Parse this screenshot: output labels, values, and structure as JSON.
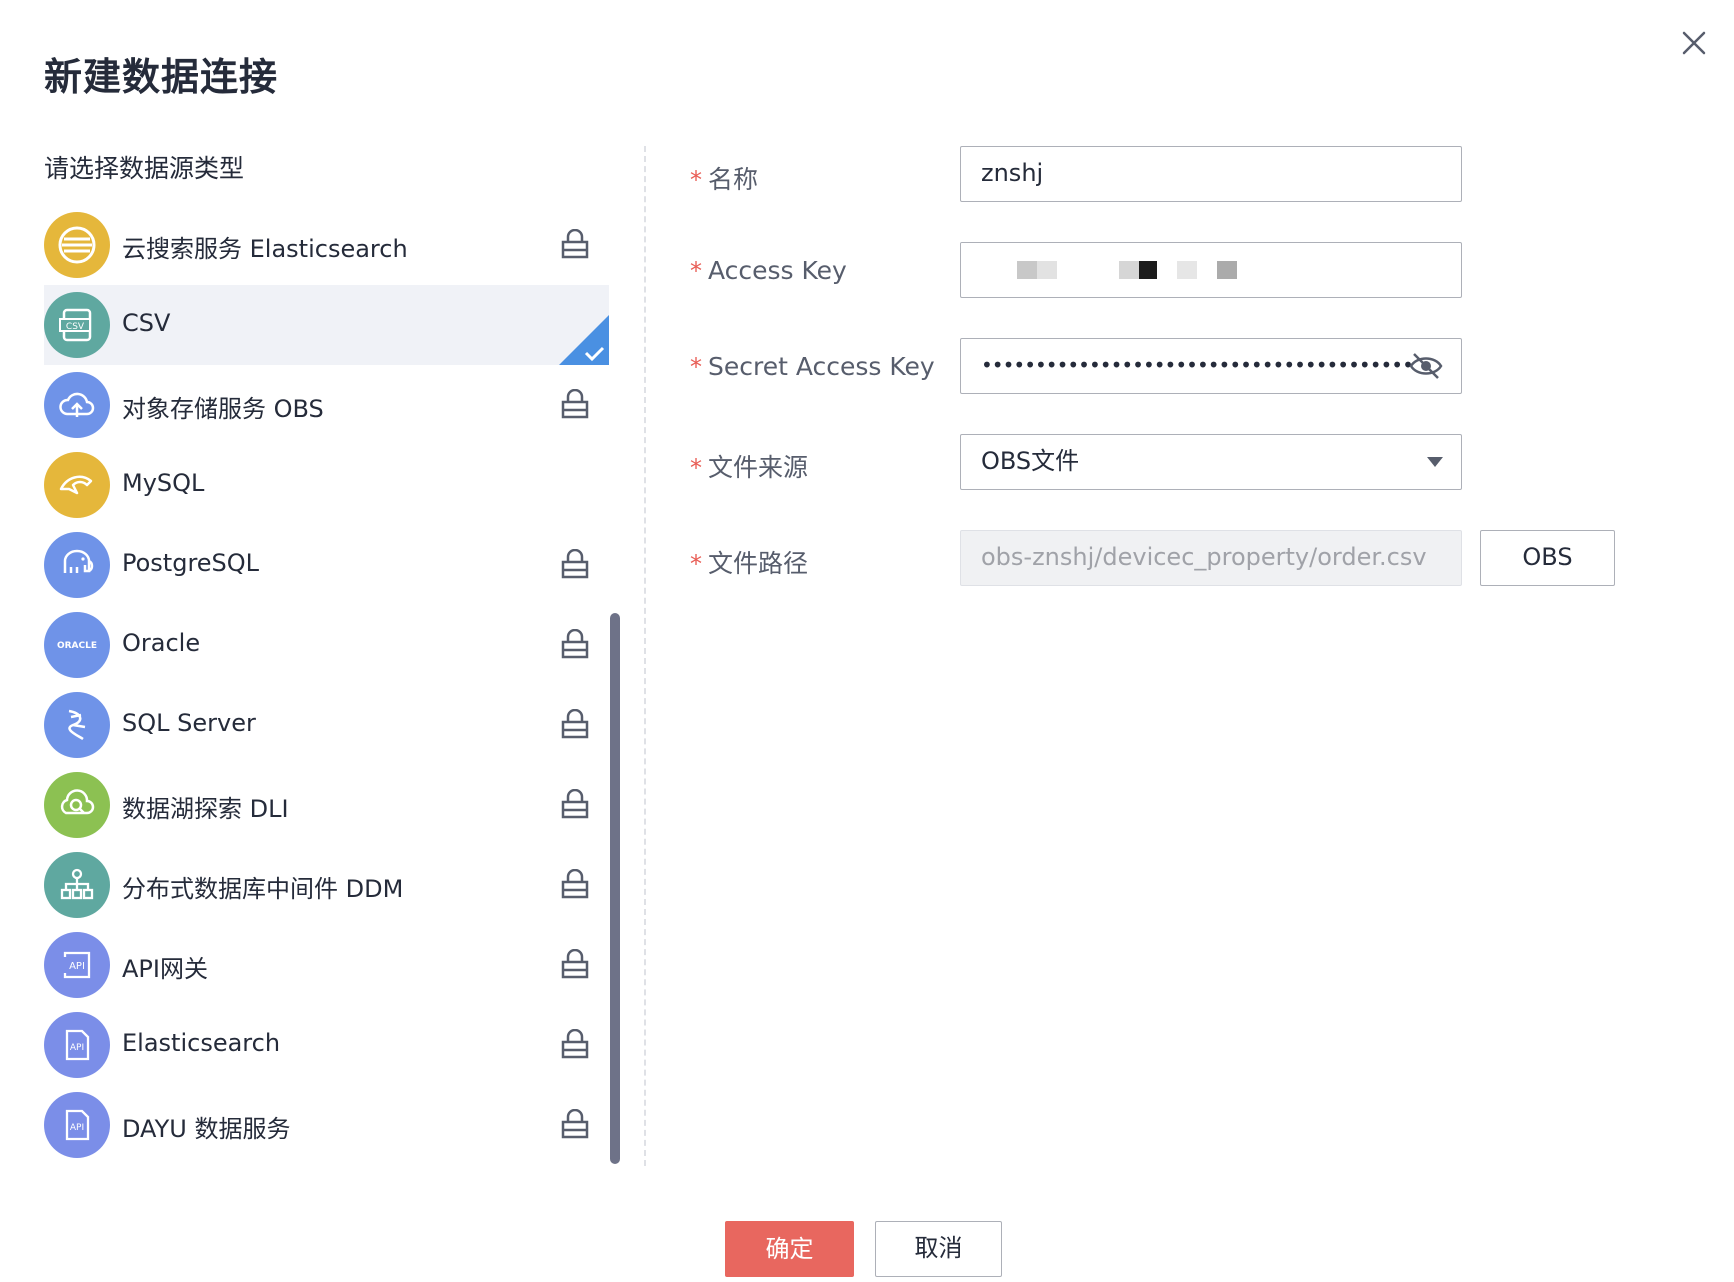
{
  "dialog": {
    "title": "新建数据连接",
    "close_icon": "close-icon"
  },
  "left": {
    "section_label": "请选择数据源类型",
    "items": [
      {
        "label": "云搜索服务 Elasticsearch",
        "icon": "elasticsearch-service-icon",
        "color": "#e5b73b",
        "locked": true,
        "selected": false
      },
      {
        "label": "CSV",
        "icon": "csv-icon",
        "color": "#5fa8a0",
        "locked": false,
        "selected": true
      },
      {
        "label": "对象存储服务 OBS",
        "icon": "cloud-upload-icon",
        "color": "#6f93e8",
        "locked": true,
        "selected": false
      },
      {
        "label": "MySQL",
        "icon": "dolphin-icon",
        "color": "#e5b73b",
        "locked": false,
        "selected": false
      },
      {
        "label": "PostgreSQL",
        "icon": "elephant-icon",
        "color": "#6f93e8",
        "locked": true,
        "selected": false
      },
      {
        "label": "Oracle",
        "icon": "oracle-icon",
        "color": "#6f93e8",
        "locked": true,
        "selected": false
      },
      {
        "label": "SQL Server",
        "icon": "sql-server-icon",
        "color": "#6f93e8",
        "locked": true,
        "selected": false
      },
      {
        "label": "数据湖探索 DLI",
        "icon": "data-lake-icon",
        "color": "#8cc152",
        "locked": true,
        "selected": false
      },
      {
        "label": "分布式数据库中间件 DDM",
        "icon": "distributed-tree-icon",
        "color": "#5fa8a0",
        "locked": true,
        "selected": false
      },
      {
        "label": "API网关",
        "icon": "api-gateway-icon",
        "color": "#7b8ee8",
        "locked": true,
        "selected": false
      },
      {
        "label": "Elasticsearch",
        "icon": "api-document-icon",
        "color": "#7b8ee8",
        "locked": true,
        "selected": false
      },
      {
        "label": "DAYU 数据服务",
        "icon": "api-document-icon",
        "color": "#7b8ee8",
        "locked": true,
        "selected": false
      }
    ],
    "oracle_text": "ORACLE",
    "csv_text": "CSV",
    "api_text": "API"
  },
  "form": {
    "name": {
      "label": "名称",
      "value": "znshj"
    },
    "access_key": {
      "label": "Access Key"
    },
    "secret_key": {
      "label": "Secret Access Key",
      "value": "••••••••••••••••••••••••••••••••••••••••"
    },
    "file_source": {
      "label": "文件来源",
      "value": "OBS文件"
    },
    "file_path": {
      "label": "文件路径",
      "value": "obs-znshj/devicec_property/order.csv",
      "button": "OBS"
    },
    "required_mark": "*"
  },
  "footer": {
    "ok": "确定",
    "cancel": "取消"
  },
  "colors": {
    "accent": "#e8675f",
    "selected_check": "#4a90e2",
    "required": "#e85c54"
  }
}
